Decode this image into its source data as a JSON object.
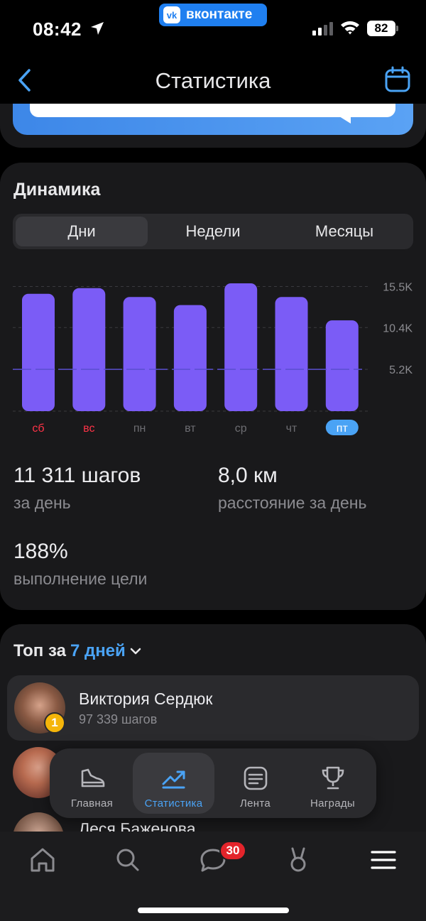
{
  "status_bar": {
    "time": "08:42",
    "app_pill": "вконтакте",
    "vk_logo": "vk",
    "battery": "82"
  },
  "nav": {
    "title": "Статистика",
    "back_icon": "chevron-left-icon",
    "calendar_icon": "calendar-icon"
  },
  "dynamics": {
    "title": "Динамика",
    "tabs": [
      "Дни",
      "Недели",
      "Месяцы"
    ],
    "active_tab": "Дни"
  },
  "chart_data": {
    "type": "bar",
    "categories": [
      "сб",
      "вс",
      "пн",
      "вт",
      "ср",
      "чт",
      "пт"
    ],
    "values": [
      14600,
      15300,
      14200,
      13200,
      15900,
      14200,
      11300
    ],
    "ylim": [
      0,
      15900
    ],
    "y_ticks": [
      "15.5K",
      "10.4K",
      "5.2K"
    ],
    "weekend_color": "#ff3347",
    "bar_color": "#7b5cf6",
    "selected": "пт"
  },
  "stats": {
    "steps_value": "11 311 шагов",
    "steps_label": "за день",
    "distance_value": "8,0 км",
    "distance_label": "расстояние за день",
    "goal_value": "188%",
    "goal_label": "выполнение цели"
  },
  "top": {
    "prefix": "Топ за",
    "period": "7 дней",
    "users": [
      {
        "name": "Виктория Сердюк",
        "steps": "97 339 шагов",
        "rank": "1"
      },
      {
        "name": "Леся Баженова"
      }
    ]
  },
  "float_nav": [
    {
      "label": "Главная",
      "icon": "sneaker-icon"
    },
    {
      "label": "Статистика",
      "icon": "trend-icon"
    },
    {
      "label": "Лента",
      "icon": "feed-icon"
    },
    {
      "label": "Награды",
      "icon": "trophy-icon"
    }
  ],
  "tab_bar": {
    "messages_badge": "30"
  },
  "colors": {
    "accent": "#4aa3f5",
    "card": "#19191b",
    "purple": "#7b5cf6"
  }
}
